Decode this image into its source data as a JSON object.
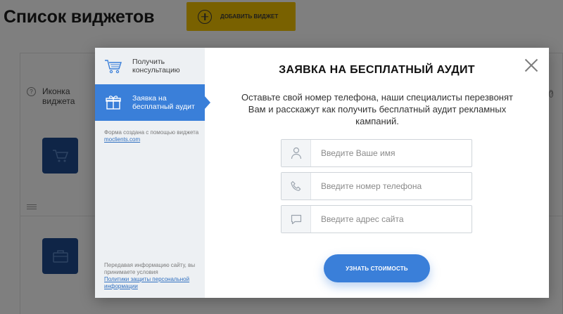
{
  "page": {
    "title": "Список виджетов",
    "add_widget_label": "ДОБАВИТЬ ВИДЖЕТ",
    "column_icon_label": "Иконка виджета"
  },
  "modal": {
    "sidebar": {
      "items": [
        {
          "label": "Получить консультацию",
          "icon": "cart-icon",
          "active": false
        },
        {
          "label": "Заявка на бесплатный аудит",
          "icon": "gift-icon",
          "active": true
        }
      ],
      "form_note_prefix": "Форма создана с помощью виджета",
      "form_note_link": "moclients.com",
      "privacy_prefix": "Передавая информацию сайту, вы принимаете условия",
      "privacy_link": "Политики защиты персональной информации"
    },
    "title": "ЗАЯВКА НА БЕСПЛАТНЫЙ АУДИТ",
    "description": "Оставьте свой номер телефона, наши специалисты перезвонят Вам и расскажут как получить бесплатный аудит рекламных кампаний.",
    "fields": {
      "name_placeholder": "Введите Ваше имя",
      "phone_placeholder": "Введите номер телефона",
      "site_placeholder": "Введите адрес сайта"
    },
    "submit_label": "УЗНАТЬ СТОИМОСТЬ"
  },
  "colors": {
    "accent": "#3a7fd9",
    "add_button": "#f2c200",
    "widget_icon_bg": "#1f4b8e"
  }
}
